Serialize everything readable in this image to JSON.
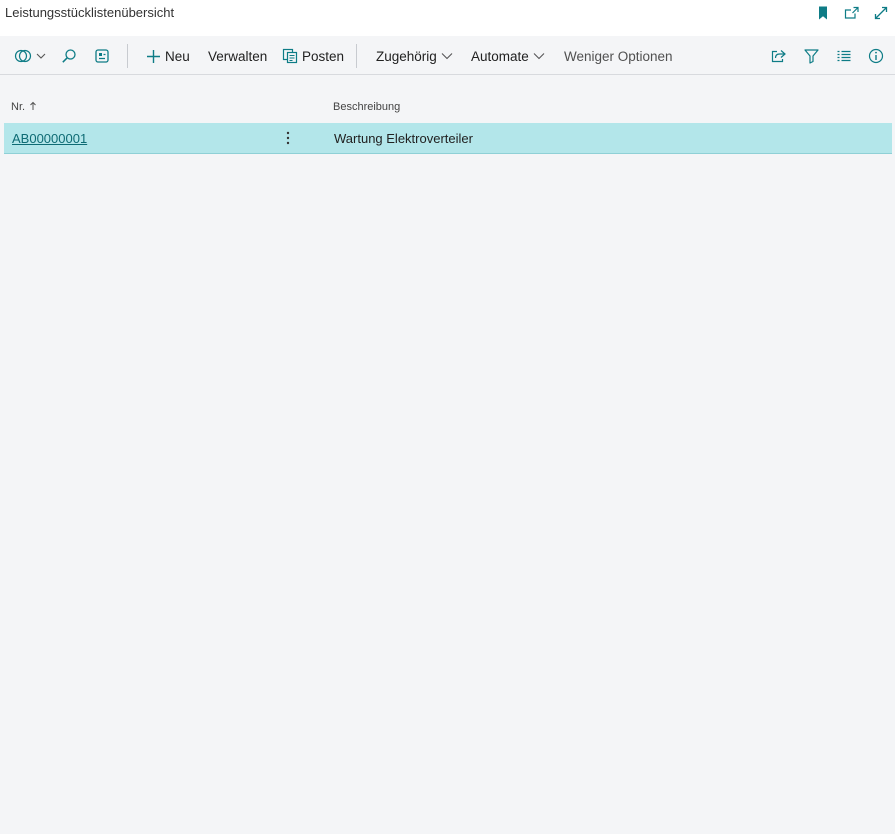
{
  "page": {
    "title": "Leistungsstücklistenübersicht"
  },
  "title_actions": [
    {
      "name": "bookmark-icon"
    },
    {
      "name": "open-new-window-icon"
    },
    {
      "name": "expand-icon"
    }
  ],
  "toolbar": {
    "new_label": "Neu",
    "manage_label": "Verwalten",
    "entries_label": "Posten",
    "related_label": "Zugehörig",
    "automate_label": "Automate",
    "fewer_options_label": "Weniger Optionen"
  },
  "table": {
    "columns": [
      {
        "label": "Nr.",
        "sort": "ascending"
      },
      {
        "label": "Beschreibung"
      }
    ],
    "rows": [
      {
        "no": "AB00000001",
        "description": "Wartung Elektroverteiler",
        "selected": true
      }
    ]
  },
  "colors": {
    "accent": "#0e7c86",
    "selected_row": "#b3e6ea",
    "background": "#f4f5f7"
  }
}
